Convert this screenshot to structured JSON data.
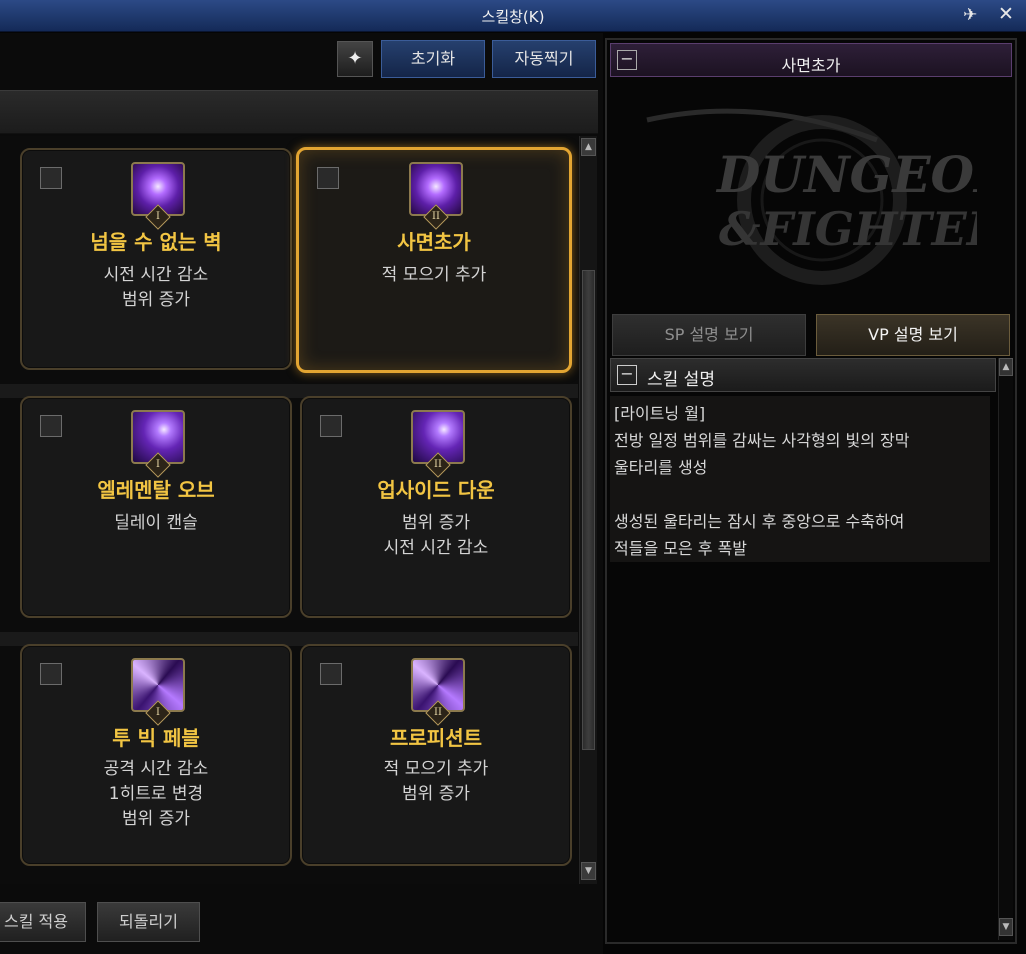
{
  "window": {
    "title": "스킬창(K)"
  },
  "toolbar": {
    "reset_label": "초기화",
    "auto_label": "자동찍기"
  },
  "skills": [
    {
      "name": "넘을 수 없는 벽",
      "tier": "I",
      "icon": "lightning-wall-icon",
      "lines": [
        "시전 시간 감소",
        "범위 증가"
      ],
      "selected": false
    },
    {
      "name": "사면초가",
      "tier": "II",
      "icon": "lightning-wall-icon",
      "lines": [
        "적 모으기 추가"
      ],
      "selected": true
    },
    {
      "name": "엘레멘탈 오브",
      "tier": "I",
      "icon": "orb-icon",
      "lines": [
        "딜레이 캔슬"
      ],
      "selected": false
    },
    {
      "name": "업사이드 다운",
      "tier": "II",
      "icon": "orb-icon",
      "lines": [
        "범위 증가",
        "시전 시간 감소"
      ],
      "selected": false
    },
    {
      "name": "투 빅 페블",
      "tier": "I",
      "icon": "swirl-icon",
      "lines": [
        "공격 시간 감소",
        "1히트로 변경",
        "범위 증가"
      ],
      "selected": false
    },
    {
      "name": "프로피션트",
      "tier": "II",
      "icon": "swirl-icon",
      "lines": [
        "적 모으기 추가",
        "범위 증가"
      ],
      "selected": false
    }
  ],
  "bottom": {
    "apply_label": "스킬 적용",
    "revert_label": "되돌리기"
  },
  "detail": {
    "title": "사면초가",
    "logo_text_1": "DUNGEON",
    "logo_text_2": "&FIGHTER",
    "tab_sp": "SP 설명 보기",
    "tab_vp": "VP 설명 보기",
    "active_tab": "vp",
    "section_title": "스킬 설명",
    "description": [
      "[라이트닝 월]",
      "전방 일정 범위를 감싸는 사각형의 빛의 장막",
      "울타리를 생성",
      "",
      "생성된 울타리는 잠시 후 중앙으로 수축하여",
      "적들을 모은 후 폭발"
    ]
  }
}
